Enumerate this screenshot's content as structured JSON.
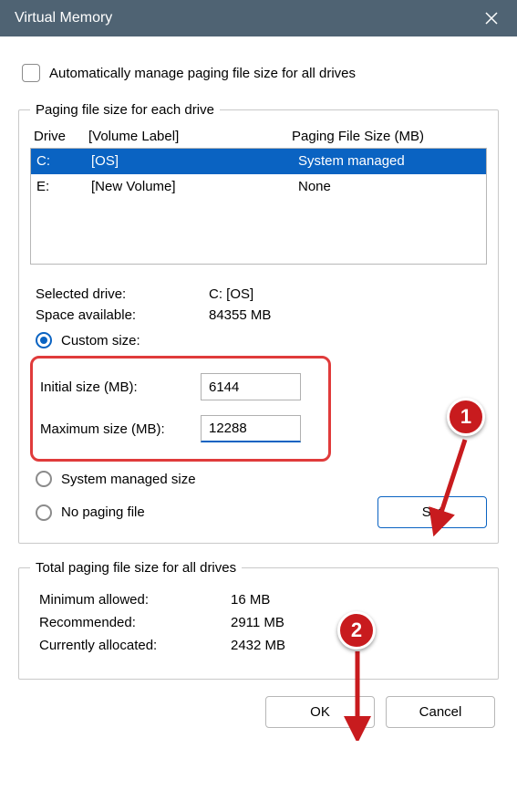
{
  "window": {
    "title": "Virtual Memory"
  },
  "auto": {
    "label": "Automatically manage paging file size for all drives",
    "checked": false
  },
  "group1": {
    "legend": "Paging file size for each drive",
    "header_drive": "Drive",
    "header_label": "[Volume Label]",
    "header_size": "Paging File Size (MB)",
    "drives": [
      {
        "letter": "C:",
        "label": "[OS]",
        "size": "System managed",
        "selected": true
      },
      {
        "letter": "E:",
        "label": "[New Volume]",
        "size": "None",
        "selected": false
      }
    ],
    "selected_drive_label": "Selected drive:",
    "selected_drive_value": "C:  [OS]",
    "space_label": "Space available:",
    "space_value": "84355 MB",
    "radio_custom": "Custom size:",
    "initial_label": "Initial size (MB):",
    "initial_value": "6144",
    "maximum_label": "Maximum size (MB):",
    "maximum_value": "12288",
    "radio_system": "System managed size",
    "radio_none": "No paging file",
    "set_label": "Set"
  },
  "group2": {
    "legend": "Total paging file size for all drives",
    "min_label": "Minimum allowed:",
    "min_value": "16 MB",
    "rec_label": "Recommended:",
    "rec_value": "2911 MB",
    "cur_label": "Currently allocated:",
    "cur_value": "2432 MB"
  },
  "footer": {
    "ok": "OK",
    "cancel": "Cancel"
  },
  "markers": {
    "m1": "1",
    "m2": "2"
  }
}
